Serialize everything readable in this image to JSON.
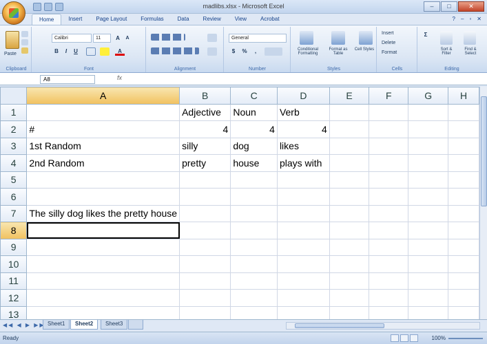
{
  "window": {
    "title": "madlibs.xlsx - Microsoft Excel"
  },
  "ribbon_tabs": [
    "Home",
    "Insert",
    "Page Layout",
    "Formulas",
    "Data",
    "Review",
    "View",
    "Acrobat"
  ],
  "ribbon": {
    "paste_label": "Paste",
    "font_name": "Calibri",
    "font_size": "11",
    "number_format": "General",
    "styles_buttons": [
      "Conditional Formatting",
      "Format as Table",
      "Cell Styles"
    ],
    "cells_buttons": [
      "Insert",
      "Delete",
      "Format"
    ],
    "editing_buttons": [
      "Sort & Filter",
      "Find & Select"
    ],
    "group_labels": [
      "Clipboard",
      "Font",
      "Alignment",
      "Number",
      "Styles",
      "Cells",
      "Editing"
    ]
  },
  "formula_bar": {
    "name_box": "A8",
    "fx": "fx",
    "formula": ""
  },
  "columns": [
    "A",
    "B",
    "C",
    "D",
    "E",
    "F",
    "G",
    "H"
  ],
  "selected_column": "A",
  "selected_row": "8",
  "rows": [
    {
      "n": "1",
      "cells": [
        "",
        "Adjective",
        "Noun",
        "Verb",
        "",
        "",
        "",
        ""
      ]
    },
    {
      "n": "2",
      "cells": [
        "#",
        "4",
        "4",
        "4",
        "",
        "",
        "",
        ""
      ]
    },
    {
      "n": "3",
      "cells": [
        "1st Random",
        "silly",
        "dog",
        "likes",
        "",
        "",
        "",
        ""
      ]
    },
    {
      "n": "4",
      "cells": [
        "2nd Random",
        "pretty",
        "house",
        "plays with",
        "",
        "",
        "",
        ""
      ]
    },
    {
      "n": "5",
      "cells": [
        "",
        "",
        "",
        "",
        "",
        "",
        "",
        ""
      ]
    },
    {
      "n": "6",
      "cells": [
        "",
        "",
        "",
        "",
        "",
        "",
        "",
        ""
      ]
    },
    {
      "n": "7",
      "cells": [
        "The silly dog likes the pretty house",
        "",
        "",
        "",
        "",
        "",
        "",
        ""
      ]
    },
    {
      "n": "8",
      "cells": [
        "",
        "",
        "",
        "",
        "",
        "",
        "",
        ""
      ]
    },
    {
      "n": "9",
      "cells": [
        "",
        "",
        "",
        "",
        "",
        "",
        "",
        ""
      ]
    },
    {
      "n": "10",
      "cells": [
        "",
        "",
        "",
        "",
        "",
        "",
        "",
        ""
      ]
    },
    {
      "n": "11",
      "cells": [
        "",
        "",
        "",
        "",
        "",
        "",
        "",
        ""
      ]
    },
    {
      "n": "12",
      "cells": [
        "",
        "",
        "",
        "",
        "",
        "",
        "",
        ""
      ]
    },
    {
      "n": "13",
      "cells": [
        "",
        "",
        "",
        "",
        "",
        "",
        "",
        ""
      ]
    }
  ],
  "sheets": [
    "Sheet1",
    "Sheet2",
    "Sheet3"
  ],
  "active_sheet": "Sheet2",
  "status": {
    "mode": "Ready",
    "zoom": "100%"
  },
  "colors": {
    "accent": "#15428b",
    "selection": "#f1c15f"
  }
}
